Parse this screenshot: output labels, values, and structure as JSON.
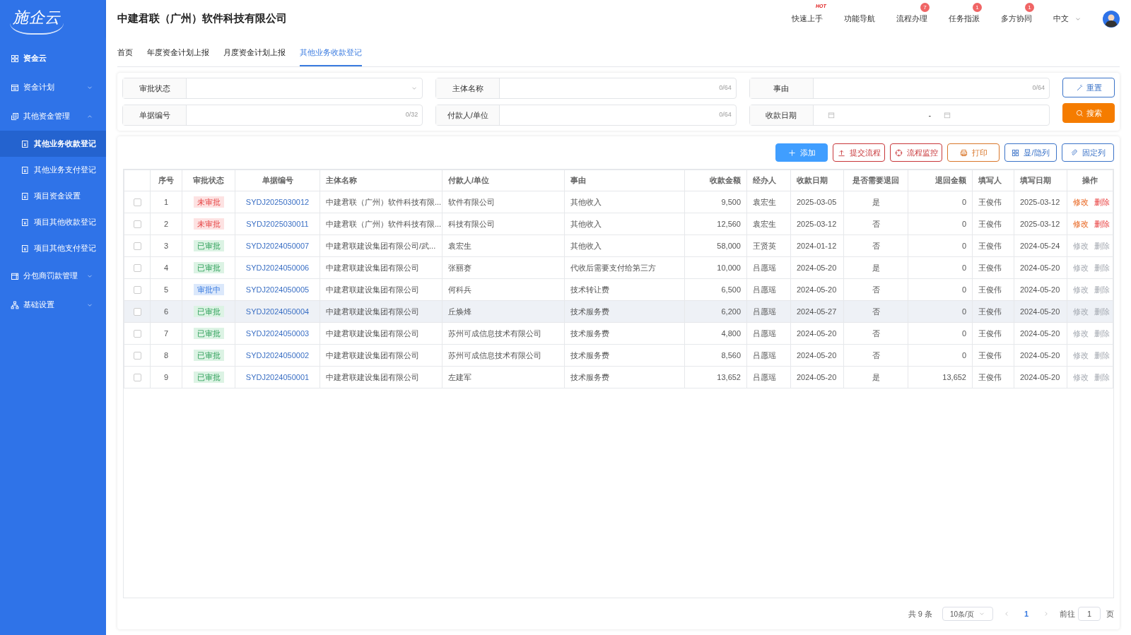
{
  "sidebar": {
    "logo": "施企云",
    "items": [
      {
        "label": "资金云",
        "kind": "home"
      },
      {
        "label": "资金计划",
        "kind": "group",
        "expanded": false
      },
      {
        "label": "其他资金管理",
        "kind": "group",
        "expanded": true,
        "children": [
          {
            "label": "其他业务收款登记",
            "selected": true
          },
          {
            "label": "其他业务支付登记",
            "selected": false
          },
          {
            "label": "项目资金设置",
            "selected": false
          },
          {
            "label": "项目其他收款登记",
            "selected": false
          },
          {
            "label": "项目其他支付登记",
            "selected": false
          }
        ]
      },
      {
        "label": "分包商罚款管理",
        "kind": "group",
        "expanded": false
      },
      {
        "label": "基础设置",
        "kind": "group",
        "expanded": false
      }
    ]
  },
  "header": {
    "title": "中建君联（广州）软件科技有限公司",
    "nav": [
      {
        "label": "快速上手",
        "badge": {
          "text": "HOT",
          "kind": "hot"
        }
      },
      {
        "label": "功能导航"
      },
      {
        "label": "流程办理",
        "badge": {
          "text": "7",
          "kind": "count"
        }
      },
      {
        "label": "任务指派",
        "badge": {
          "text": "1",
          "kind": "count"
        }
      },
      {
        "label": "多方协同",
        "badge": {
          "text": "1",
          "kind": "count"
        }
      }
    ],
    "language": "中文"
  },
  "tabs": [
    {
      "label": "首页",
      "selected": false
    },
    {
      "label": "年度资金计划上报",
      "selected": false
    },
    {
      "label": "月度资金计划上报",
      "selected": false
    },
    {
      "label": "其他业务收款登记",
      "selected": true
    }
  ],
  "filters": [
    {
      "label": "审批状态",
      "kind": "select"
    },
    {
      "label": "主体名称",
      "kind": "text",
      "counter": "0/64"
    },
    {
      "label": "事由",
      "kind": "text",
      "counter": "0/64"
    },
    {
      "label": "单据编号",
      "kind": "text",
      "counter": "0/32"
    },
    {
      "label": "付款人/单位",
      "kind": "text",
      "counter": "0/64"
    },
    {
      "label": "收款日期",
      "kind": "daterange",
      "separator": "-"
    }
  ],
  "filter_buttons": [
    {
      "label": "重置",
      "kind": "reset"
    },
    {
      "label": "搜索",
      "kind": "search"
    }
  ],
  "toolbar": [
    {
      "label": "添加",
      "kind": "primary",
      "color": "#409eff"
    },
    {
      "label": "提交流程",
      "kind": "outline",
      "color": "#c8373a"
    },
    {
      "label": "流程监控",
      "kind": "outline",
      "color": "#c8373a"
    },
    {
      "label": "打印",
      "kind": "outline",
      "color": "#d9772b"
    },
    {
      "label": "显/隐列",
      "kind": "outline",
      "color": "#3b73c8"
    },
    {
      "label": "固定列",
      "kind": "outline",
      "color": "#3b73c8"
    }
  ],
  "table": {
    "columns": [
      "序号",
      "审批状态",
      "单据编号",
      "主体名称",
      "付款人/单位",
      "事由",
      "收款金额",
      "经办人",
      "收款日期",
      "是否需要退回",
      "退回金额",
      "填写人",
      "填写日期",
      "操作"
    ],
    "rows": [
      {
        "checked": false,
        "hovered": false,
        "index": "1",
        "status": {
          "label": "未审批",
          "kind": "pending"
        },
        "number": "SYDJ2025030012",
        "entity": "中建君联（广州）软件科技有限...",
        "payer": "软件有限公司",
        "reason": "其他收入",
        "amount": "9,500",
        "handler": "袁宏生",
        "date": "2025-03-05",
        "refund": "是",
        "refund_amount": "0",
        "author": "王俊伟",
        "filled_date": "2025-03-12",
        "actions": [
          "修改",
          "删除"
        ],
        "actions_enabled": true
      },
      {
        "checked": false,
        "hovered": false,
        "index": "2",
        "status": {
          "label": "未审批",
          "kind": "pending"
        },
        "number": "SYDJ2025030011",
        "entity": "中建君联（广州）软件科技有限...",
        "payer": "科技有限公司",
        "reason": "其他收入",
        "amount": "12,560",
        "handler": "袁宏生",
        "date": "2025-03-12",
        "refund": "否",
        "refund_amount": "0",
        "author": "王俊伟",
        "filled_date": "2025-03-12",
        "actions": [
          "修改",
          "删除"
        ],
        "actions_enabled": true
      },
      {
        "checked": false,
        "hovered": false,
        "index": "3",
        "status": {
          "label": "已审批",
          "kind": "approved"
        },
        "number": "SYDJ2024050007",
        "entity": "中建君联建设集团有限公司/武...",
        "payer": "袁宏生",
        "reason": "其他收入",
        "amount": "58,000",
        "handler": "王贤英",
        "date": "2024-01-12",
        "refund": "否",
        "refund_amount": "0",
        "author": "王俊伟",
        "filled_date": "2024-05-24",
        "actions": [
          "修改",
          "删除"
        ],
        "actions_enabled": false
      },
      {
        "checked": false,
        "hovered": false,
        "index": "4",
        "status": {
          "label": "已审批",
          "kind": "approved"
        },
        "number": "SYDJ2024050006",
        "entity": "中建君联建设集团有限公司",
        "payer": "张丽赛",
        "reason": "代收后需要支付给第三方",
        "amount": "10,000",
        "handler": "吕愿瑶",
        "date": "2024-05-20",
        "refund": "是",
        "refund_amount": "0",
        "author": "王俊伟",
        "filled_date": "2024-05-20",
        "actions": [
          "修改",
          "删除"
        ],
        "actions_enabled": false
      },
      {
        "checked": false,
        "hovered": false,
        "index": "5",
        "status": {
          "label": "审批中",
          "kind": "in_review"
        },
        "number": "SYDJ2024050005",
        "entity": "中建君联建设集团有限公司",
        "payer": "何科兵",
        "reason": "技术转让费",
        "amount": "6,500",
        "handler": "吕愿瑶",
        "date": "2024-05-20",
        "refund": "否",
        "refund_amount": "0",
        "author": "王俊伟",
        "filled_date": "2024-05-20",
        "actions": [
          "修改",
          "删除"
        ],
        "actions_enabled": false
      },
      {
        "checked": false,
        "hovered": true,
        "index": "6",
        "status": {
          "label": "已审批",
          "kind": "approved"
        },
        "number": "SYDJ2024050004",
        "entity": "中建君联建设集团有限公司",
        "payer": "丘焕烽",
        "reason": "技术服务费",
        "amount": "6,200",
        "handler": "吕愿瑶",
        "date": "2024-05-27",
        "refund": "否",
        "refund_amount": "0",
        "author": "王俊伟",
        "filled_date": "2024-05-20",
        "actions": [
          "修改",
          "删除"
        ],
        "actions_enabled": false
      },
      {
        "checked": false,
        "hovered": false,
        "index": "7",
        "status": {
          "label": "已审批",
          "kind": "approved"
        },
        "number": "SYDJ2024050003",
        "entity": "中建君联建设集团有限公司",
        "payer": "苏州可成信息技术有限公司",
        "reason": "技术服务费",
        "amount": "4,800",
        "handler": "吕愿瑶",
        "date": "2024-05-20",
        "refund": "否",
        "refund_amount": "0",
        "author": "王俊伟",
        "filled_date": "2024-05-20",
        "actions": [
          "修改",
          "删除"
        ],
        "actions_enabled": false
      },
      {
        "checked": false,
        "hovered": false,
        "index": "8",
        "status": {
          "label": "已审批",
          "kind": "approved"
        },
        "number": "SYDJ2024050002",
        "entity": "中建君联建设集团有限公司",
        "payer": "苏州可成信息技术有限公司",
        "reason": "技术服务费",
        "amount": "8,560",
        "handler": "吕愿瑶",
        "date": "2024-05-20",
        "refund": "否",
        "refund_amount": "0",
        "author": "王俊伟",
        "filled_date": "2024-05-20",
        "actions": [
          "修改",
          "删除"
        ],
        "actions_enabled": false
      },
      {
        "checked": false,
        "hovered": false,
        "index": "9",
        "status": {
          "label": "已审批",
          "kind": "approved"
        },
        "number": "SYDJ2024050001",
        "entity": "中建君联建设集团有限公司",
        "payer": "左建军",
        "reason": "技术服务费",
        "amount": "13,652",
        "handler": "吕愿瑶",
        "date": "2024-05-20",
        "refund": "是",
        "refund_amount": "13,652",
        "author": "王俊伟",
        "filled_date": "2024-05-20",
        "actions": [
          "修改",
          "删除"
        ],
        "actions_enabled": false
      }
    ]
  },
  "pagination": {
    "total": "共 9 条",
    "page_size": "10条/页",
    "pages": [
      {
        "label": "1",
        "selected": true
      }
    ],
    "goto_label": "前往",
    "goto_value": "1",
    "goto_suffix": "页"
  }
}
